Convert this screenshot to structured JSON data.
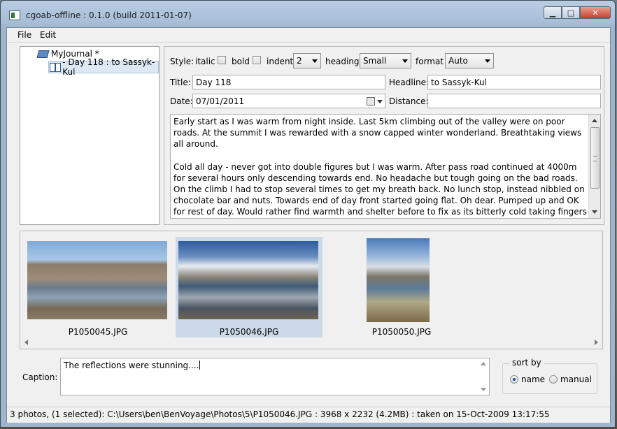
{
  "window": {
    "title": "cgoab-offline : 0.1.0 (build 2011-01-07)",
    "buttons": {
      "minimize": "▁",
      "maximize": "□",
      "close": "✕"
    }
  },
  "menu": [
    {
      "label": "File",
      "mnemonic": "F"
    },
    {
      "label": "Edit",
      "mnemonic": "E"
    }
  ],
  "tree": {
    "root": "MyJournal *",
    "child": "- Day 118 : to Sassyk-Kul"
  },
  "format": {
    "style_label": "Style:",
    "italic_label": "italic",
    "bold_label": "bold",
    "indent_label": "indent",
    "indent_value": "2",
    "heading_label": "heading",
    "heading_value": "Small",
    "format_label": "format",
    "format_value": "Auto"
  },
  "fields": {
    "title_label": "Title:",
    "title_value": "Day 118",
    "headline_label": "Headline:",
    "headline_value": "to Sassyk-Kul",
    "date_label": "Date:",
    "date_value": "07/01/2011",
    "distance_label": "Distance:",
    "distance_value": ""
  },
  "body_text": {
    "p1": "Early start as I was warm from night inside. Last 5km climbing out of the valley were on poor roads. At the summit I was rewarded with a snow capped winter wonderland. Breathtaking views all around.",
    "p2": "Cold all day - never got into double figures but I was warm. After pass road continued at 4000m for several hours only descending towards end. No headache but tough going on the bad roads. On the climb I had to stop several times to get my breath back. No lunch stop, instead nibbled on chocolate bar and nuts. Towards end of day front started going flat. Oh dear. Pumped up and OK for rest of day. Would rather find warmth and shelter before to fix as its bitterly cold taking fingers out of gloves. Air still most most of the day. Once again very little traffic - only a few cars and several convoys each with 4 or 5 Chinese trucks - an odd sight really. One had stopped to fix something at the side of the road and was surrounded."
  },
  "photos": [
    {
      "name": "P1050045.JPG",
      "selected": false
    },
    {
      "name": "P1050046.JPG",
      "selected": true
    },
    {
      "name": "P1050050.JPG",
      "selected": false
    }
  ],
  "caption": {
    "label": "Caption:",
    "value": "The reflections were stunning...."
  },
  "sort": {
    "legend": "sort by",
    "options": [
      "name",
      "manual"
    ],
    "selected": "name"
  },
  "status": "3 photos, (1 selected): C:\\Users\\ben\\BenVoyage\\Photos\\5\\P1050046.JPG : 3968 x 2232 (4.2MB)  : taken on 15-Oct-2009 13:17:55",
  "colors": {
    "selection": "#cbd9e8",
    "tree_selection": "#dde8f4"
  }
}
